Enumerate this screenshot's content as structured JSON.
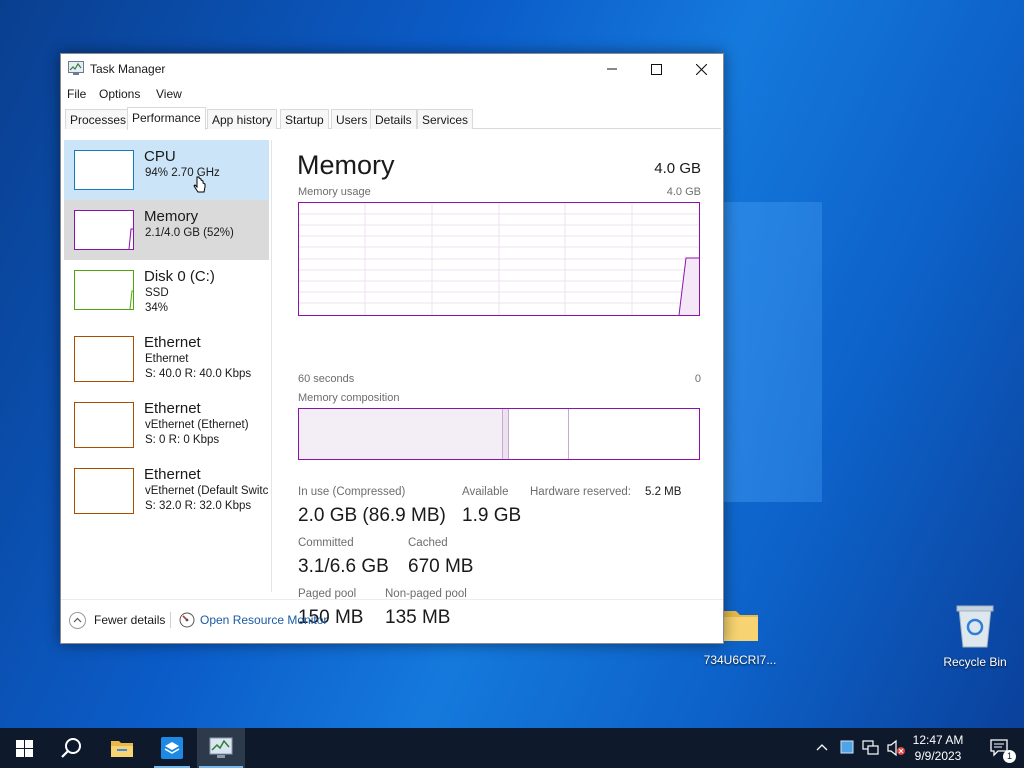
{
  "window": {
    "title": "Task Manager",
    "menu": [
      "File",
      "Options",
      "View"
    ],
    "tabs": [
      "Processes",
      "Performance",
      "App history",
      "Startup",
      "Users",
      "Details",
      "Services"
    ],
    "active_tab": "Performance"
  },
  "resources": [
    {
      "name": "CPU",
      "line1": "94%  2.70 GHz",
      "line2": "",
      "color": "#117dbb",
      "state": "selected"
    },
    {
      "name": "Memory",
      "line1": "2.1/4.0 GB (52%)",
      "line2": "",
      "color": "#8b12ae",
      "state": "hover"
    },
    {
      "name": "Disk 0 (C:)",
      "line1": "SSD",
      "line2": "34%",
      "color": "#4da60c"
    },
    {
      "name": "Ethernet",
      "line1": "Ethernet",
      "line2": "S: 40.0  R: 40.0 Kbps",
      "color": "#a74f01"
    },
    {
      "name": "Ethernet",
      "line1": "vEthernet (Ethernet)",
      "line2": "S: 0  R: 0 Kbps",
      "color": "#a74f01"
    },
    {
      "name": "Ethernet",
      "line1": "vEthernet (Default Switc",
      "line2": "S: 32.0  R: 32.0 Kbps",
      "color": "#a74f01"
    }
  ],
  "memory": {
    "title": "Memory",
    "total": "4.0 GB",
    "usage_label": "Memory usage",
    "usage_max": "4.0 GB",
    "time_label": "60 seconds",
    "time_min": "0",
    "composition_label": "Memory composition",
    "stats": {
      "in_use_label": "In use (Compressed)",
      "in_use_value": "2.0 GB (86.9 MB)",
      "available_label": "Available",
      "available_value": "1.9 GB",
      "hw_reserved_label": "Hardware reserved:",
      "hw_reserved_value": "5.2 MB",
      "committed_label": "Committed",
      "committed_value": "3.1/6.6 GB",
      "cached_label": "Cached",
      "cached_value": "670 MB",
      "paged_label": "Paged pool",
      "paged_value": "150 MB",
      "nonpaged_label": "Non-paged pool",
      "nonpaged_value": "135 MB"
    }
  },
  "footer": {
    "fewer_details": "Fewer details",
    "resource_monitor": "Open Resource Monitor"
  },
  "desktop": {
    "folder_label": "734U6CRI7...",
    "recycle_label": "Recycle Bin"
  },
  "taskbar": {
    "time": "12:47 AM",
    "date": "9/9/2023",
    "notification_count": "1"
  },
  "colors": {
    "memory_accent": "#8b12ae",
    "selected_bg": "#cce4f7",
    "link": "#1a5aa6"
  }
}
